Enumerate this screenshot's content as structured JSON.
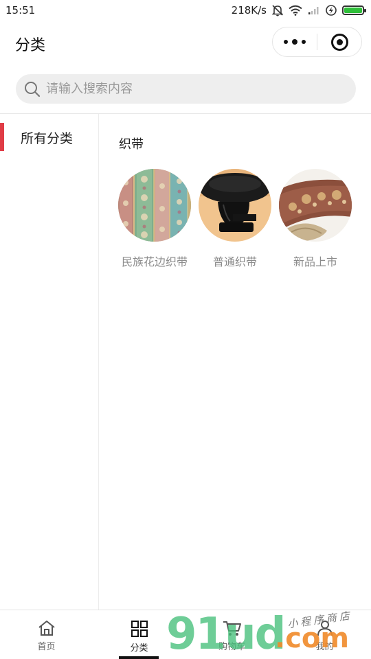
{
  "status_bar": {
    "time": "15:51",
    "speed": "218K/s"
  },
  "nav": {
    "title": "分类"
  },
  "search": {
    "placeholder": "请输入搜索内容",
    "value": ""
  },
  "sidebar": {
    "items": [
      {
        "label": "所有分类",
        "active": true
      }
    ]
  },
  "content": {
    "category_title": "织带",
    "goods": [
      {
        "label": "民族花边织带",
        "image": "ethnic-lace-ribbon-photo"
      },
      {
        "label": "普通织带",
        "image": "black-webbing-roll-photo"
      },
      {
        "label": "新品上市",
        "image": "brown-floral-ribbon-photo"
      }
    ]
  },
  "tabbar": {
    "tabs": [
      {
        "label": "首页",
        "icon": "home-icon"
      },
      {
        "label": "分类",
        "icon": "grid-icon",
        "active": true
      },
      {
        "label": "购物车",
        "icon": "cart-icon"
      },
      {
        "label": "我的",
        "icon": "user-icon"
      }
    ]
  },
  "watermark": {
    "main": "91ud",
    "suffix": ".com",
    "tagline": "小程序商店"
  },
  "colors": {
    "accent": "#e03c46",
    "search_bg": "#eeeeee",
    "battery": "#2fbf3a"
  }
}
